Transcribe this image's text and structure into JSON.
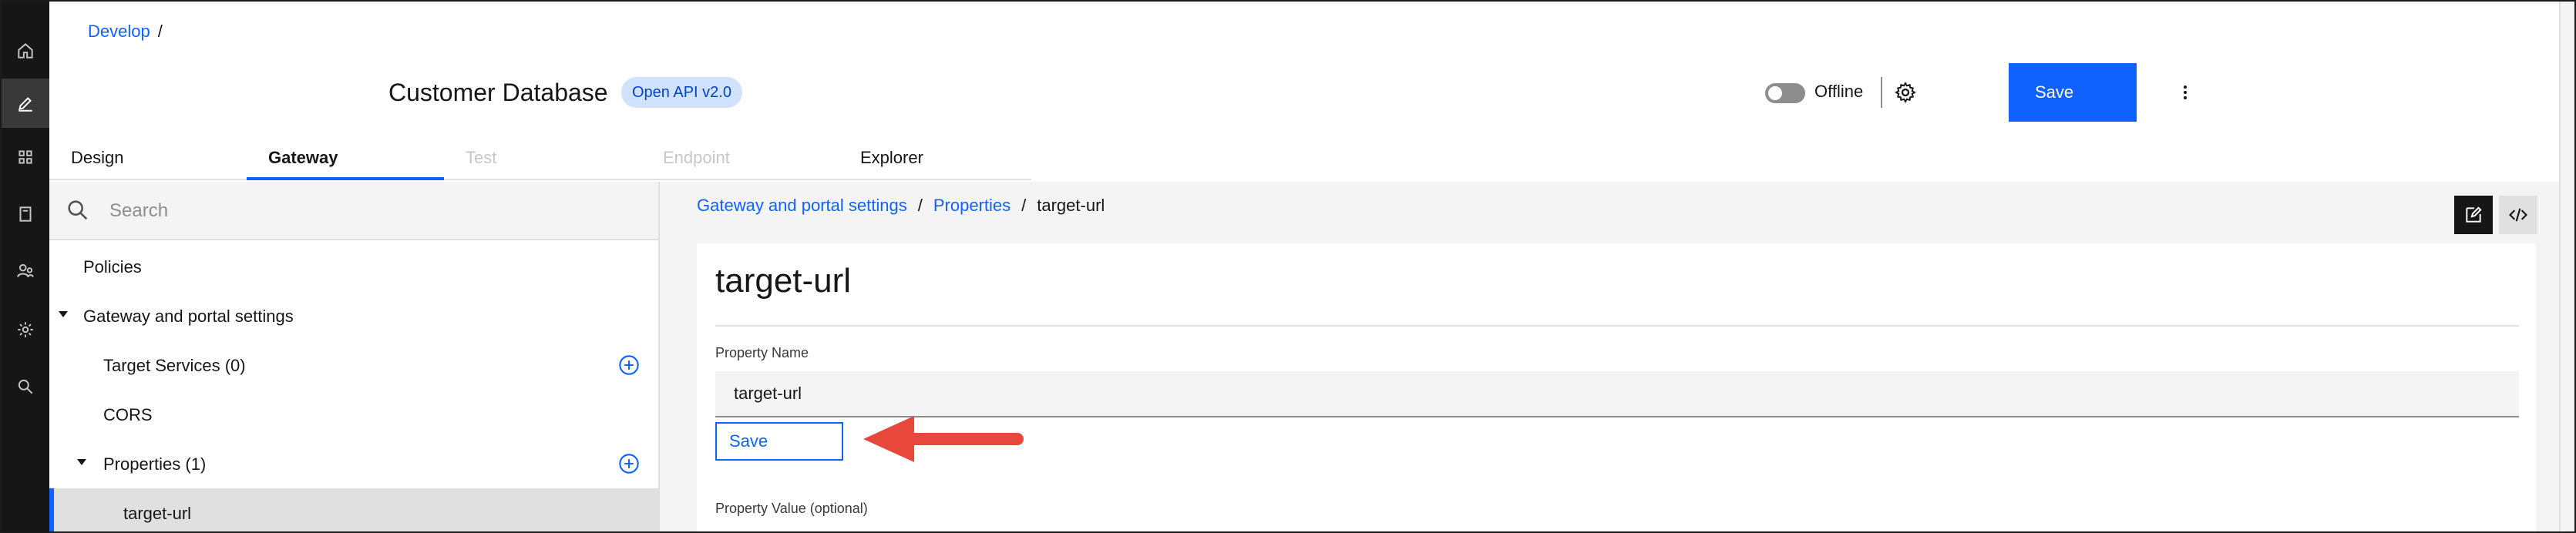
{
  "rail": {
    "items": [
      {
        "name": "home-icon",
        "active": false
      },
      {
        "name": "edit-icon",
        "active": true
      },
      {
        "name": "apps-icon",
        "active": false
      },
      {
        "name": "catalog-icon",
        "active": false
      },
      {
        "name": "users-icon",
        "active": false
      },
      {
        "name": "settings-icon",
        "active": false
      },
      {
        "name": "search-icon",
        "active": false
      }
    ]
  },
  "header": {
    "breadcrumb": {
      "link": "Develop",
      "separator": "/"
    },
    "title": "Customer Database",
    "badge": "Open API v2.0",
    "offline_label": "Offline",
    "save_label": "Save",
    "toggle_on": false
  },
  "tabs": [
    {
      "label": "Design",
      "state": "normal"
    },
    {
      "label": "Gateway",
      "state": "active"
    },
    {
      "label": "Test",
      "state": "disabled"
    },
    {
      "label": "Endpoint",
      "state": "disabled"
    },
    {
      "label": "Explorer",
      "state": "normal"
    }
  ],
  "left": {
    "search_placeholder": "Search",
    "items": [
      {
        "label": "Policies"
      },
      {
        "label": "Gateway and portal settings"
      },
      {
        "label": "Target Services (0)"
      },
      {
        "label": "CORS"
      },
      {
        "label": "Properties (1)"
      },
      {
        "label": "target-url"
      }
    ]
  },
  "content": {
    "crumbs": {
      "first": "Gateway and portal settings",
      "second": "Properties",
      "current": "target-url",
      "separator": "/"
    },
    "card_title": "target-url",
    "property_name_label": "Property Name",
    "property_name_value": "target-url",
    "save_label": "Save",
    "property_value_label": "Property Value (optional)"
  },
  "colors": {
    "accent": "#0f62fe",
    "rail": "#161616",
    "badge_bg": "#d0e2ff",
    "annotation_arrow": "#e8473c"
  }
}
